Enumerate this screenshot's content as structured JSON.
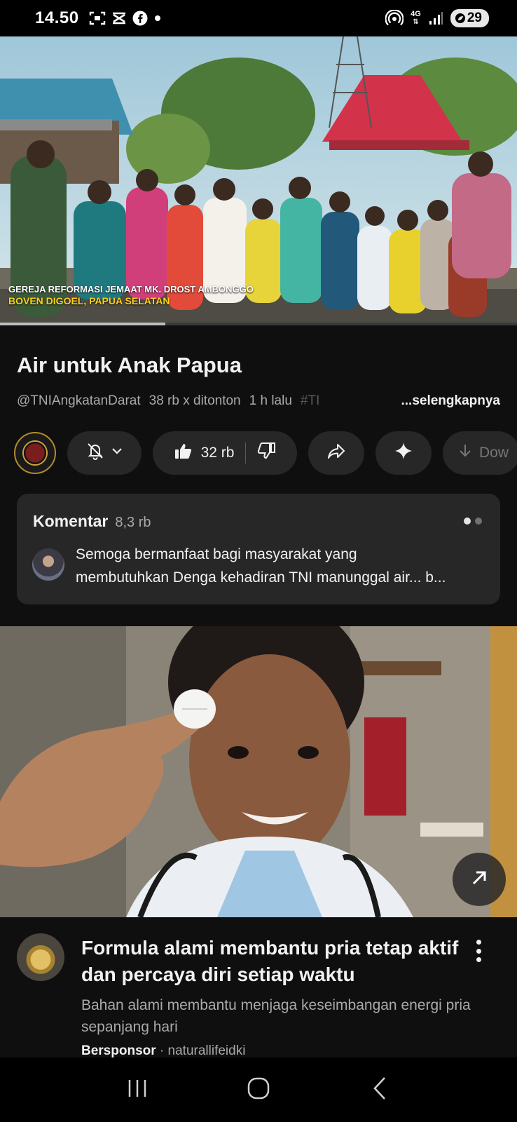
{
  "status_bar": {
    "time": "14.50",
    "network": "4G",
    "battery": "29"
  },
  "video": {
    "overlay_line1": "GEREJA REFORMASI JEMAAT MK. DROST AMBONGGO",
    "overlay_line2": "BOVEN DIGOEL, PAPUA SELATAN",
    "progress_fraction": 0.32,
    "title": "Air untuk Anak Papua",
    "channel_handle": "@TNIAngkatanDarat",
    "views": "38 rb x ditonton",
    "age": "1 h lalu",
    "hashtag": "#TI",
    "more_label": "...selengkapnya"
  },
  "actions": {
    "like_count": "32 rb",
    "download_label": "Dow"
  },
  "comments": {
    "label": "Komentar",
    "count": "8,3 rb",
    "preview_line1": "Semoga bermanfaat bagi masyarakat yang",
    "preview_line2": "membutuhkan Denga kehadiran TNI manunggal air... b..."
  },
  "ad": {
    "title": "Formula alami membantu pria tetap aktif dan percaya diri setiap waktu",
    "description": "Bahan alami membantu menjaga keseimbangan energi pria sepanjang hari",
    "sponsored_label": "Bersponsor",
    "separator": "·",
    "advertiser": "naturallifeidki"
  },
  "icons": {
    "bell": "bell-off-icon",
    "like": "thumb-up-icon",
    "dislike": "thumb-down-icon",
    "share": "share-icon",
    "ai": "sparkle-icon",
    "download": "download-icon"
  }
}
